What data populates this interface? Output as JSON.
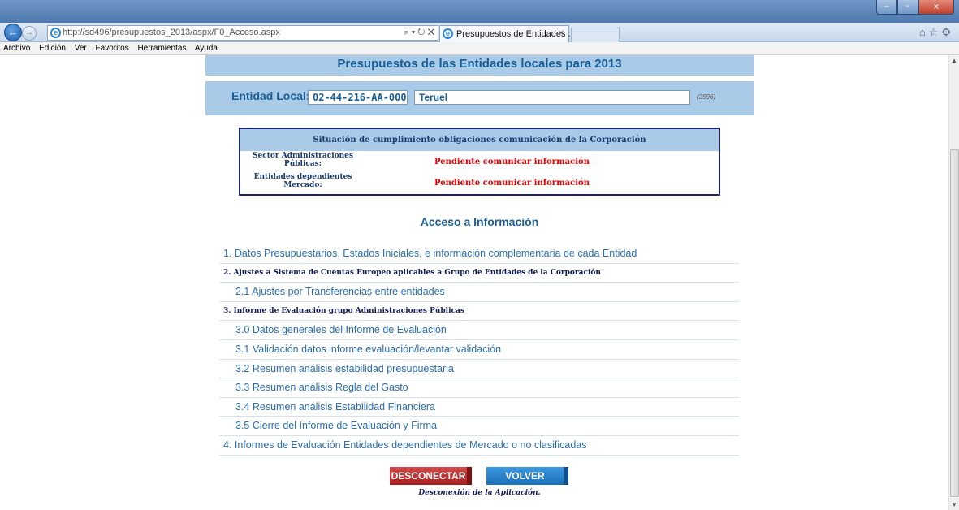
{
  "browser": {
    "url": "http://sd496/presupuestos_2013/aspx/F0_Acceso.aspx",
    "url_domain": "sd496",
    "tab_title": "Presupuestos de Entidades ...",
    "window_controls": [
      "–",
      "▫",
      "x"
    ],
    "menu": [
      "Archivo",
      "Edición",
      "Ver",
      "Favoritos",
      "Herramientas",
      "Ayuda"
    ]
  },
  "page": {
    "title": "Presupuestos de las Entidades locales para 2013",
    "entity": {
      "label": "Entidad Local:",
      "code": "02-44-216-AA-000",
      "name": "Teruel",
      "id": "(3596)"
    },
    "status": {
      "header": "Situación de cumplimiento obligaciones comunicación de la Corporación",
      "rows": [
        {
          "label": "Sector Administraciones Públicas:",
          "value": "Pendiente comunicar información"
        },
        {
          "label": "Entidades dependientes Mercado:",
          "value": "Pendiente comunicar información"
        }
      ]
    },
    "access_title": "Acceso a Información",
    "menu_items": [
      {
        "text": "1. Datos Presupuestarios, Estados Iniciales, e información complementaria de cada Entidad"
      },
      {
        "text": "2. Ajustes a Sistema de Cuentas Europeo aplicables a Grupo de Entidades de la Corporación"
      },
      {
        "text": "2.1 Ajustes por Transferencias entre entidades"
      },
      {
        "text": "3. Informe de Evaluación grupo Administraciones Públicas"
      },
      {
        "text": "3.0 Datos generales del Informe de Evaluación"
      },
      {
        "text": "3.1 Validación datos informe evaluación/levantar validación"
      },
      {
        "text": "3.2 Resumen análisis estabilidad presupuestaria"
      },
      {
        "text": "3.3 Resumen análisis Regla del Gasto"
      },
      {
        "text": "3.4 Resumen análisis Estabilidad Financiera"
      },
      {
        "text": "3.5 Cierre del Informe de Evaluación y Firma"
      },
      {
        "text": "4. Informes de Evaluación Entidades dependientes de Mercado o no clasificadas"
      }
    ],
    "buttons": {
      "disconnect": "DESCONECTAR",
      "back": "VOLVER",
      "hint": "Desconexión de la Aplicación."
    }
  },
  "colors": {
    "band": "#a9cbe8",
    "title_text": "#1a5e96",
    "link": "#2a6db3",
    "alert": "#e00000",
    "disconnect_button": "#b52727",
    "back_button": "#2a84cf"
  },
  "icons": [
    "back-arrow-icon",
    "forward-arrow-icon",
    "ie-logo-icon",
    "search-icon",
    "refresh-icon",
    "close-icon",
    "home-icon",
    "star-icon",
    "gear-icon"
  ]
}
